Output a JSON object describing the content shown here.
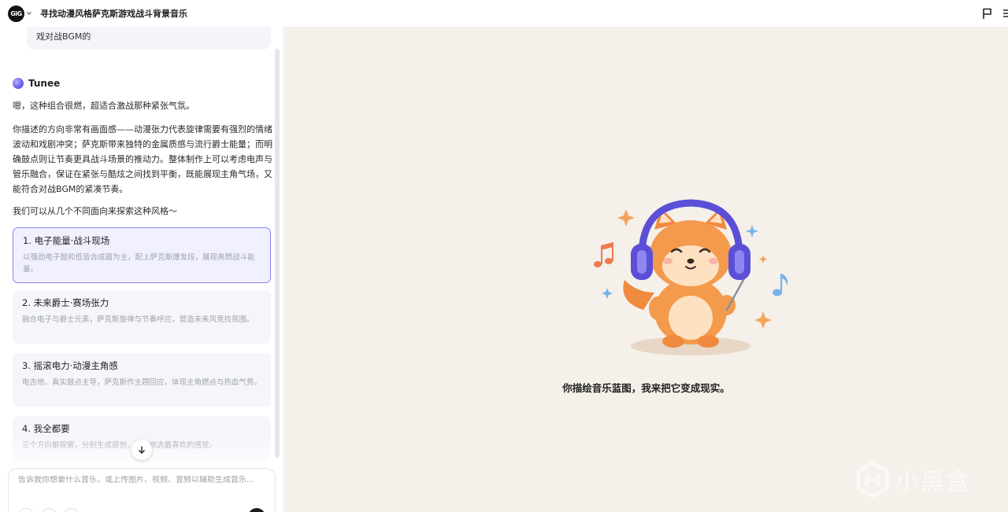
{
  "header": {
    "logo_text": "GiG",
    "title": "寻找动漫风格萨克斯游戏战斗背景音乐"
  },
  "chat": {
    "user_message_tail": "戏对战BGM的",
    "assistant_name": "Tunee",
    "messages": [
      "嗯，这种组合很燃，超适合激战那种紧张气氛。",
      "你描述的方向非常有画面感——动漫张力代表旋律需要有强烈的情绪波动和戏剧冲突；萨克斯带来独特的金属质感与流行爵士能量；而明确鼓点则让节奏更具战斗场景的推动力。整体制作上可以考虑电声与管乐融合，保证在紧张与酷炫之间找到平衡，既能展现主角气场，又能符合对战BGM的紧凑节奏。",
      "我们可以从几个不同面向来探索这种风格～"
    ],
    "options": [
      {
        "title": "1. 电子能量·战斗现场",
        "desc": "以强劲电子鼓和低音合成器为主，配上萨克斯爆发段，展现高燃战斗能量。"
      },
      {
        "title": "2. 未来爵士·赛场张力",
        "desc": "融合电子与爵士元素，萨克斯旋律与节奏呼应，营造未来风竞技氛围。"
      },
      {
        "title": "3. 摇滚电力·动漫主角感",
        "desc": "电吉他、真实鼓点主导，萨克斯作主题回应，体现主角燃点与热血气势。"
      },
      {
        "title": "4. 我全都要",
        "desc": "三个方向都探索，分别生成原创，让你挑选最喜欢的感觉。"
      }
    ]
  },
  "composer": {
    "placeholder": "告诉我你想要什么音乐，或上传图片、视频、音频以辅助生成音乐..."
  },
  "canvas": {
    "empty_text": "你描绘音乐蓝图，我来把它变成现实。",
    "watermark_text": "小黑盒"
  },
  "colors": {
    "accent": "#8a86f2",
    "canvas_bg": "#f5f0ea",
    "headphones": "#5b4fd8"
  },
  "icons": {
    "logo": "tunee-logo-icon",
    "flag": "flag-icon",
    "scroll_down": "arrow-down-icon",
    "mascot": "fox-with-headphones-illustration",
    "watermark": "xiaoheihe-logo-icon"
  }
}
